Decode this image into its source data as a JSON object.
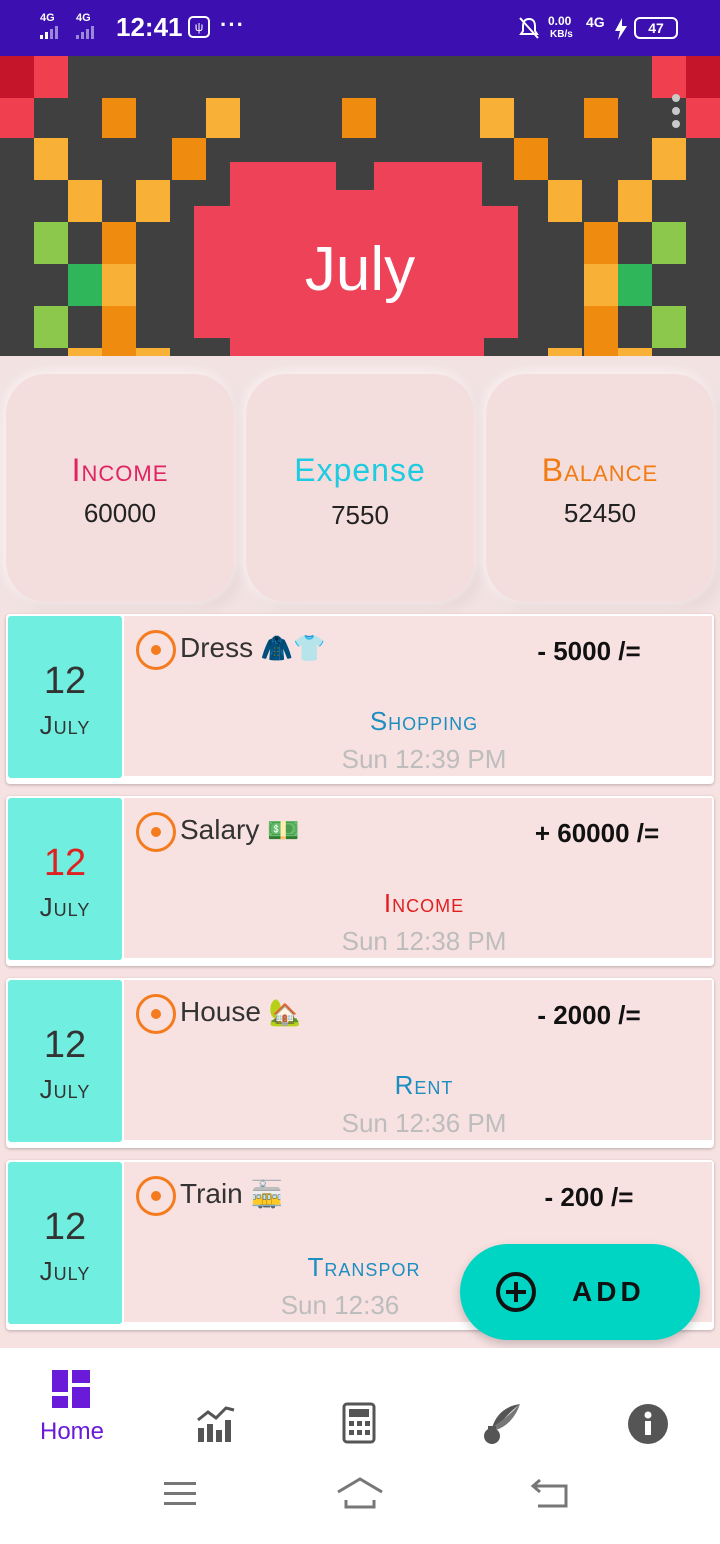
{
  "status_bar": {
    "sig1": "4G",
    "sig2": "4G",
    "time": "12:41",
    "usb_icon": "usb-icon",
    "more": "···",
    "speed": "0.00",
    "speed_unit": "KB/s",
    "net": "4G",
    "battery": "47"
  },
  "header": {
    "month_title": "July"
  },
  "summary": {
    "income": {
      "label": "Income",
      "value": "60000",
      "color": "#e0245e"
    },
    "expense": {
      "label": "Expense",
      "value": "7550",
      "color": "#1ecbe1"
    },
    "balance": {
      "label": "Balance",
      "value": "52450",
      "color": "#f07c13"
    }
  },
  "transactions": [
    {
      "day": "12",
      "month": "July",
      "name": "Dress",
      "emoji": "🧥👕",
      "amount": "- 5000 /=",
      "category": "Shopping",
      "category_color": "#1d8ec0",
      "time": "Sun 12:39 PM",
      "day_color": "#333333"
    },
    {
      "day": "12",
      "month": "July",
      "name": "Salary",
      "emoji": "💵",
      "amount": "+ 60000 /=",
      "category": "Income",
      "category_color": "#e02020",
      "time": "Sun 12:38 PM",
      "day_color": "#e02020"
    },
    {
      "day": "12",
      "month": "July",
      "name": "House",
      "emoji": "🏡",
      "amount": "- 2000 /=",
      "category": "Rent",
      "category_color": "#1d8ec0",
      "time": "Sun 12:36 PM",
      "day_color": "#333333"
    },
    {
      "day": "12",
      "month": "July",
      "name": "Train",
      "emoji": "🚋",
      "amount": "- 200 /=",
      "category": "Transpor",
      "category_color": "#1d8ec0",
      "time": "Sun 12:36",
      "day_color": "#333333"
    }
  ],
  "fab": {
    "label": "ADD",
    "icon": "add-circle-icon"
  },
  "bottom_nav": {
    "home": {
      "label": "Home",
      "icon": "dashboard-icon"
    },
    "stats_icon": "chart-icon",
    "calculator_icon": "calculator-icon",
    "notes_icon": "quill-icon",
    "info_icon": "info-icon"
  },
  "colors": {
    "status_bar": "#3b0fb0",
    "accent": "#6a1bd9",
    "date_box": "#70eedf",
    "fab": "#00d5c3",
    "banner_bg": "#404040",
    "heart": "#ee4258"
  }
}
